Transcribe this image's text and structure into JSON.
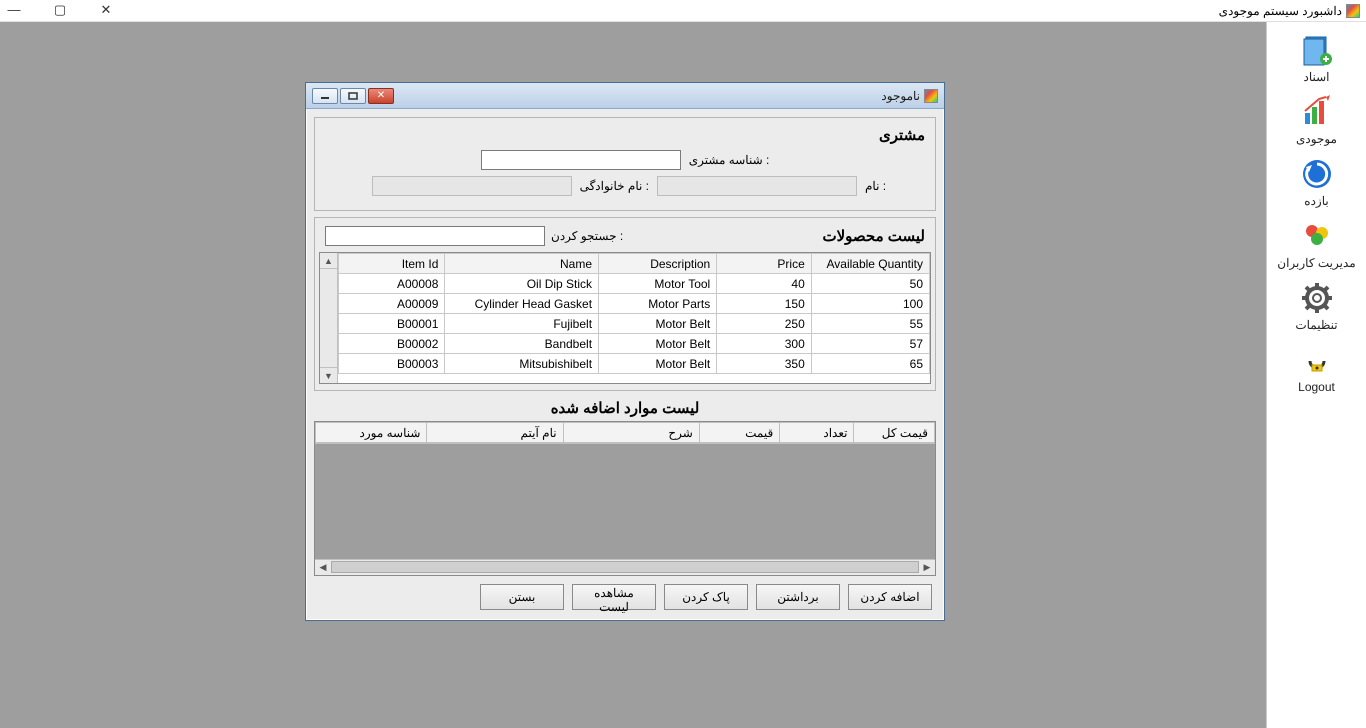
{
  "outer": {
    "title": "داشبورد سیستم موجودی"
  },
  "sidebar": {
    "items": [
      {
        "label": "اسناد"
      },
      {
        "label": "موجودی"
      },
      {
        "label": "بازده"
      },
      {
        "label": "مدیریت کاربران"
      },
      {
        "label": "تنظیمات"
      },
      {
        "label": "Logout"
      }
    ]
  },
  "child": {
    "title": "ناموجود"
  },
  "customer": {
    "panel_title": "مشتری",
    "id_label": "شناسه مشتری :",
    "name_label": "نام :",
    "lastname_label": "نام خانوادگی :"
  },
  "products": {
    "title": "لیست محصولات",
    "search_label": "جستجو کردن :",
    "columns": [
      "Item Id",
      "Name",
      "Description",
      "Price",
      "Available Quantity"
    ],
    "rows": [
      {
        "id": "A00008",
        "name": "Oil Dip Stick",
        "desc": "Motor Tool",
        "price": "40",
        "qty": "50"
      },
      {
        "id": "A00009",
        "name": "Cylinder Head Gasket",
        "desc": "Motor Parts",
        "price": "150",
        "qty": "100"
      },
      {
        "id": "B00001",
        "name": "Fujibelt",
        "desc": "Motor Belt",
        "price": "250",
        "qty": "55"
      },
      {
        "id": "B00002",
        "name": "Bandbelt",
        "desc": "Motor Belt",
        "price": "300",
        "qty": "57"
      },
      {
        "id": "B00003",
        "name": "Mitsubishibelt",
        "desc": "Motor Belt",
        "price": "350",
        "qty": "65"
      }
    ]
  },
  "added": {
    "title": "لیست موارد اضافه شده",
    "columns": [
      "شناسه مورد",
      "نام آیتم",
      "شرح",
      "قیمت",
      "تعداد",
      "قیمت کل"
    ]
  },
  "buttons": {
    "add": "اضافه کردن",
    "remove": "برداشتن",
    "clear": "پاک کردن",
    "view": "مشاهده لیست",
    "close": "بستن"
  }
}
